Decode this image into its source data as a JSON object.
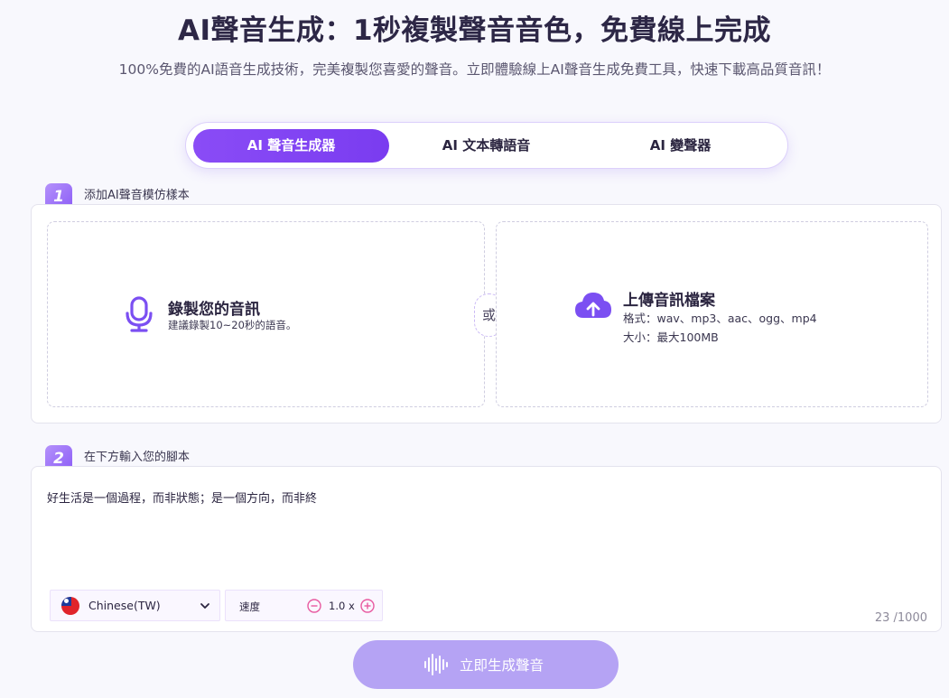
{
  "header": {
    "title": "AI聲音生成：1秒複製聲音音色，免費線上完成",
    "subtitle": "100%免費的AI語音生成技術，完美複製您喜愛的聲音。立即體驗線上AI聲音生成免費工具，快速下載高品質音訊！"
  },
  "tabs": [
    {
      "label": "AI 聲音生成器",
      "active": true
    },
    {
      "label": "AI 文本轉語音",
      "active": false
    },
    {
      "label": "AI 變聲器",
      "active": false
    }
  ],
  "step1": {
    "number": "1",
    "label": "添加AI聲音模仿樣本",
    "record": {
      "title": "錄製您的音訊",
      "hint": "建議錄製10~20秒的語音。",
      "icon": "microphone-icon"
    },
    "or_label": "或",
    "upload": {
      "title": "上傳音訊檔案",
      "formats": "格式：wav、mp3、aac、ogg、mp4",
      "size": "大小：最大100MB",
      "icon": "cloud-upload-icon"
    }
  },
  "step2": {
    "number": "2",
    "label": "在下方輸入您的腳本",
    "script_text": "好生活是一個過程，而非狀態；是一個方向，而非終",
    "language": "Chinese(TW)",
    "speed_label": "速度",
    "speed_value": "1.0 x",
    "counter": "23 /1000"
  },
  "generate_button": {
    "label": "立即生成聲音",
    "icon": "waveform-icon"
  },
  "colors": {
    "accent": "#7f41f2",
    "accent_light": "#b5a3f4",
    "upload_icon": "#7b4ff2"
  }
}
